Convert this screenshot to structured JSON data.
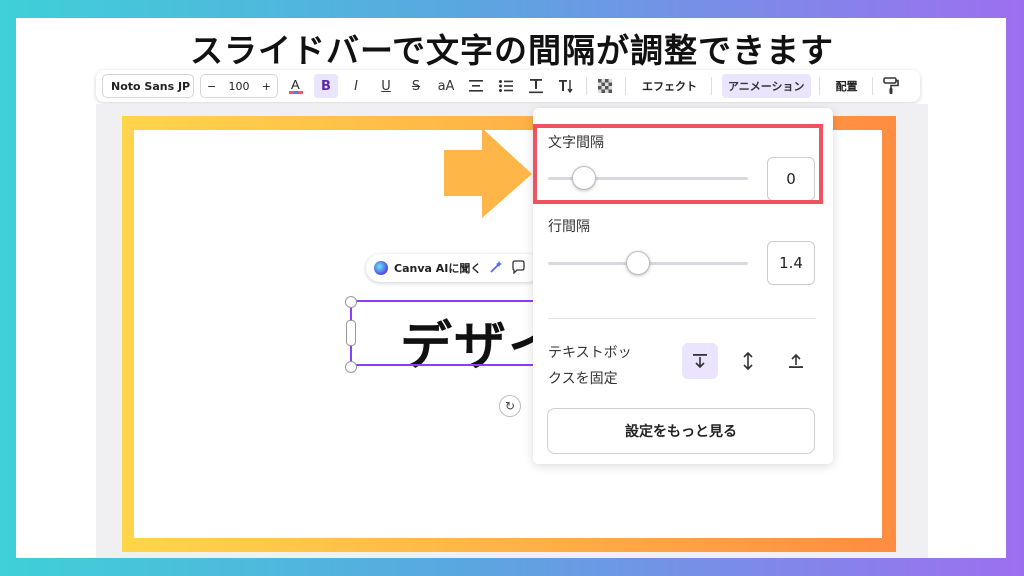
{
  "headline": "スライドバーで文字の間隔が調整できます",
  "toolbar": {
    "font_name": "Noto Sans JP",
    "size_minus": "−",
    "size_value": "100",
    "size_plus": "+",
    "bold_label": "B",
    "italic_label": "I",
    "underline_label": "U",
    "strike_label": "S",
    "case_label": "aA",
    "effects_label": "エフェクト",
    "animation_label": "アニメーション",
    "position_label": "配置"
  },
  "canvas": {
    "ai_pill_label": "Canva AIに聞く",
    "text_content": "デザイ"
  },
  "panel": {
    "letter_spacing_label": "文字間隔",
    "letter_spacing_value": "0",
    "letter_spacing_level": 0.18,
    "line_spacing_label": "行間隔",
    "line_spacing_value": "1.4",
    "line_spacing_level": 0.45,
    "anchor_label_line1": "テキストボッ",
    "anchor_label_line2": "クスを固定",
    "more_settings_label": "設定をもっと見る"
  },
  "colors": {
    "accent_purple": "#8b3dff",
    "highlight_red": "#ef5361",
    "arrow_orange": "#ffb648"
  }
}
